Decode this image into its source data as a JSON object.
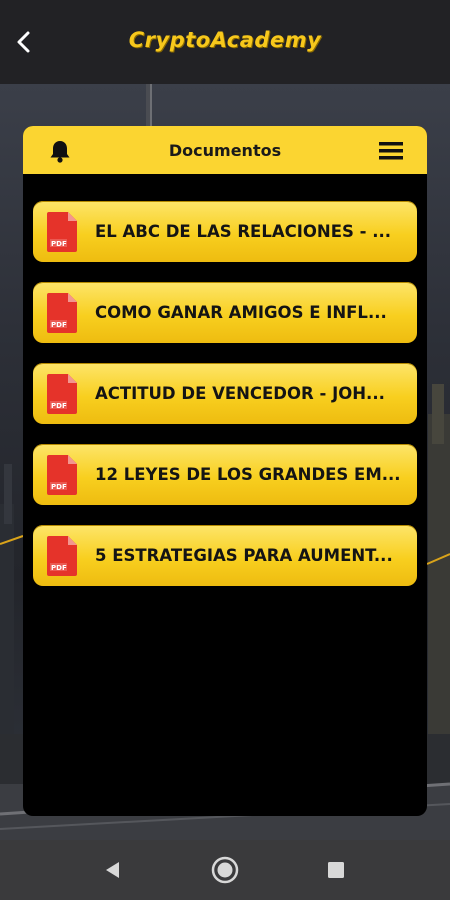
{
  "app": {
    "brand": "CryptoAcademy",
    "brand_color": "#f7c81c"
  },
  "card": {
    "title": "Documentos",
    "header_color": "#fbd531"
  },
  "documents": [
    {
      "title": "EL ABC DE LAS RELACIONES - ...",
      "icon": "pdf-icon",
      "icon_label": "PDF"
    },
    {
      "title": "COMO GANAR AMIGOS E INFL...",
      "icon": "pdf-icon",
      "icon_label": "PDF"
    },
    {
      "title": "ACTITUD DE VENCEDOR - JOH...",
      "icon": "pdf-icon",
      "icon_label": "PDF"
    },
    {
      "title": "12 LEYES DE LOS GRANDES EM...",
      "icon": "pdf-icon",
      "icon_label": "PDF"
    },
    {
      "title": "5 ESTRATEGIAS PARA AUMENT...",
      "icon": "pdf-icon",
      "icon_label": "PDF"
    }
  ],
  "icons": {
    "back": "chevron-left-icon",
    "bell": "bell-icon",
    "menu": "hamburger-menu-icon",
    "nav_back": "triangle-back-icon",
    "nav_home": "circle-home-icon",
    "nav_recents": "square-recents-icon"
  }
}
